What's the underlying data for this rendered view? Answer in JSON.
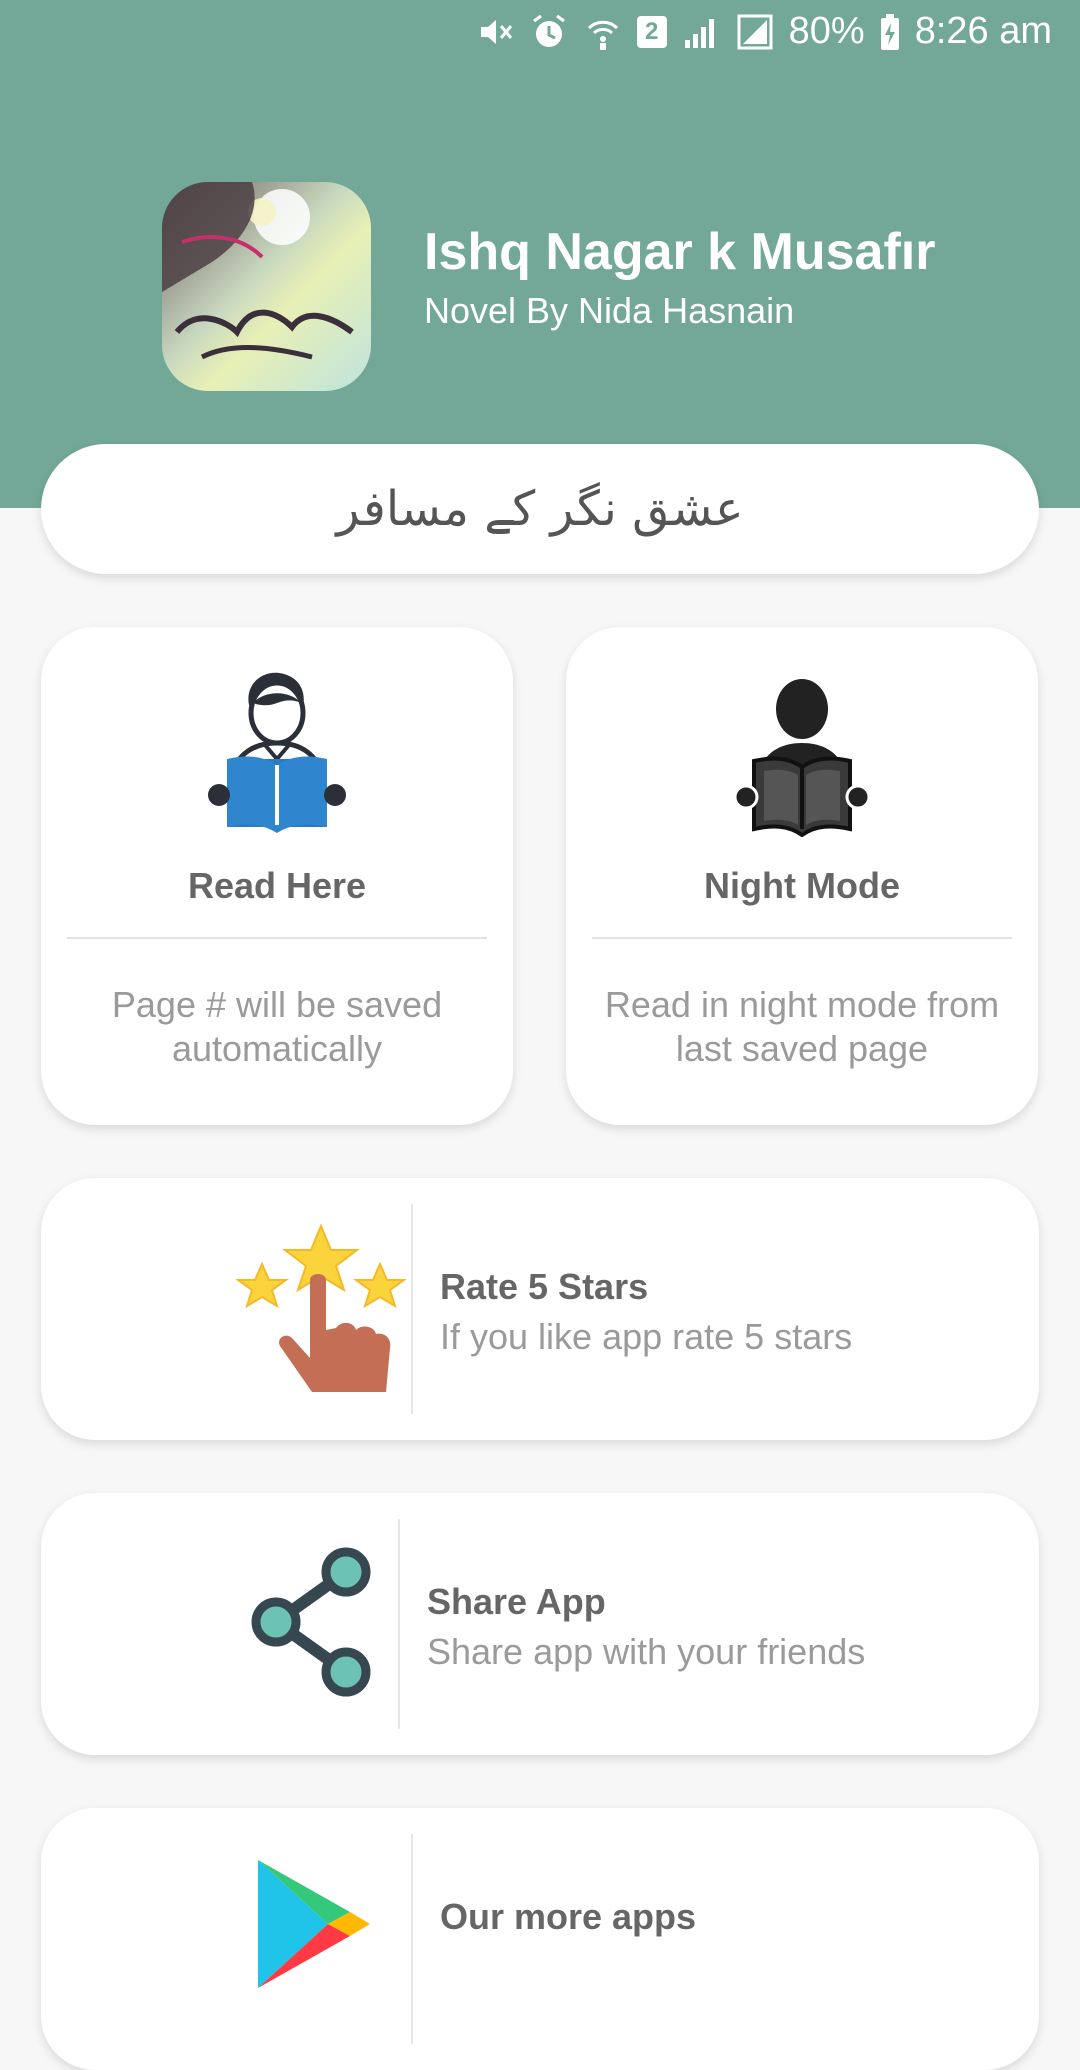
{
  "status_bar": {
    "battery": "80%",
    "time": "8:26 am",
    "sim_slot": "2"
  },
  "app": {
    "title": "Ishq Nagar k Musafır",
    "subtitle": "Novel By Nida Hasnain",
    "urdu_title": "عشق نگر کے مسافر"
  },
  "tiles": [
    {
      "label": "Read Here",
      "description": "Page # will be saved automatically",
      "icon": "reader-icon"
    },
    {
      "label": "Night Mode",
      "description": "Read in night mode from last saved page",
      "icon": "night-reader-icon"
    }
  ],
  "rows": {
    "rate": {
      "title": "Rate 5 Stars",
      "description": "If you like app rate 5 stars"
    },
    "share": {
      "title": "Share App",
      "description": "Share app with your friends"
    },
    "more": {
      "title": "Our more apps"
    }
  },
  "colors": {
    "header": "#73a898",
    "background": "#f7f7f7",
    "star": "#fbd43b",
    "share_icon": "#37474f",
    "share_dot": "#6cc3b3"
  }
}
